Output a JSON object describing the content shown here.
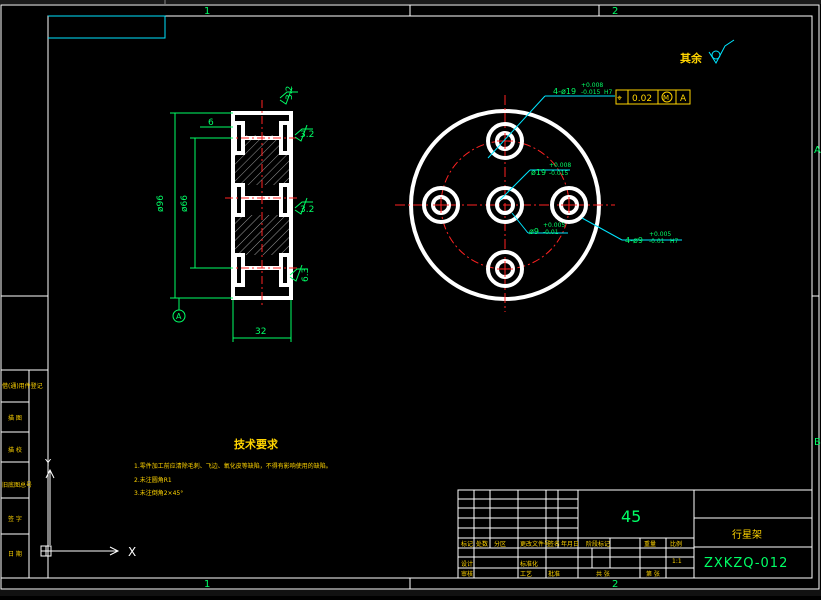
{
  "colors": {
    "background": "#000000",
    "frame": "#ffffff",
    "part": "#ffffff",
    "dimension": "#00ff66",
    "center_line": "#ff2222",
    "leader": "#00e5ff",
    "tolerance_box": "#ffd400",
    "ucs": "#ffffff"
  },
  "zone_marks": {
    "top": [
      "1",
      "2"
    ],
    "bottom": [
      "1",
      "2"
    ],
    "right": [
      "A",
      "B"
    ]
  },
  "roughness_default": "其余",
  "side_view": {
    "roughness": [
      "3.2",
      "3.2",
      "3.2",
      "6.3"
    ],
    "dims": {
      "overall_dia": "ø96",
      "inner_dia": "ø66",
      "small": "6",
      "width": "32"
    },
    "datum": "A"
  },
  "front_view": {
    "callouts": {
      "hole4_19": "4-ø19",
      "hole4_19_tol_up": "+0.008",
      "hole4_19_tol_dn": "-0.015",
      "hole4_19_suffix": "H7",
      "center19": "ø19",
      "center19_tol_up": "+0.008",
      "center19_tol_dn": "-0.015",
      "center9": "ø9",
      "center9_tol_up": "+0.005",
      "center9_tol_dn": "-0.01",
      "hole4_9": "4-ø9",
      "hole4_9_tol_up": "+0.005",
      "hole4_9_tol_dn": "-0.01",
      "hole4_9_suffix": "H7"
    },
    "position_tolerance": {
      "symbol": "⌖",
      "value": "0.02",
      "modifier": "M",
      "datum": "A"
    }
  },
  "technical_requirements": {
    "title": "技术要求",
    "items": [
      "1.零件加工前应清除毛刺、飞边、氧化皮等缺陷，不得有影响使用的缺陷。",
      "2.未注圆角R1",
      "3.未注倒角2×45°"
    ]
  },
  "left_strip_labels": [
    "借(通)用件登记",
    "描 图",
    "描 校",
    "旧底图总号",
    "签 字",
    "日 期"
  ],
  "title_block": {
    "material": "45",
    "part_name": "行星架",
    "drawing_no": "ZXKZQ-012",
    "row_labels": {
      "mark": "标记",
      "count": "处数",
      "division": "分区",
      "change_doc": "更改文件号",
      "sign": "签名",
      "date": "年月日",
      "design": "设计",
      "standardize": "标准化",
      "stage_mark": "阶段标记",
      "weight": "重量",
      "scale": "比例",
      "check": "审核",
      "process": "工艺",
      "approve": "批准",
      "sheet_total": "共 张",
      "sheet_no": "第 张"
    },
    "scale_value": "1:1"
  },
  "ucs": {
    "x": "X",
    "y": "Y"
  }
}
